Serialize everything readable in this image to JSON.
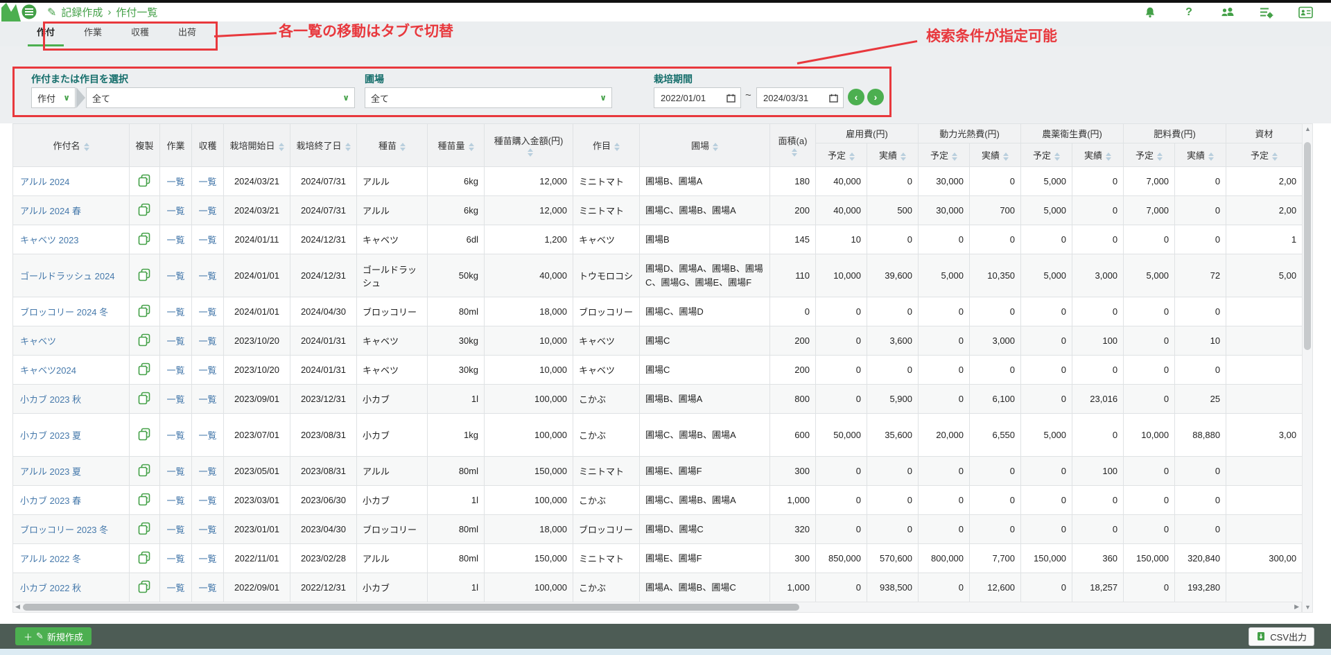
{
  "colors": {
    "accent_green": "#4caf50",
    "annotation_red": "#e8383d",
    "link_blue": "#4679ab",
    "label_teal": "#156e6b",
    "footer_bg": "#4d5c55"
  },
  "app": {
    "breadcrumb_section": "記録作成",
    "breadcrumb_sep": "›",
    "breadcrumb_page": "作付一覧",
    "help_icon_glyph": "?"
  },
  "tabs": {
    "items": [
      {
        "label": "作付",
        "active": true
      },
      {
        "label": "作業",
        "active": false
      },
      {
        "label": "収穫",
        "active": false
      },
      {
        "label": "出荷",
        "active": false
      }
    ]
  },
  "annotations": {
    "tabs_note": "各一覧の移動はタブで切替",
    "search_note": "検索条件が指定可能"
  },
  "filters": {
    "planting_label": "作付または作目を選択",
    "type_value": "作付",
    "type_chevron": "∨",
    "planting_value": "全て",
    "chevron": "∨",
    "field_label": "圃場",
    "field_value": "全て",
    "period_label": "栽培期間",
    "date_from": "2022/01/01",
    "date_to": "2024/03/31",
    "tilde": "~",
    "prev_glyph": "‹",
    "next_glyph": "›"
  },
  "table": {
    "headers": {
      "name": "作付名",
      "copy": "複製",
      "work": "作業",
      "harvest": "収穫",
      "start": "栽培開始日",
      "end": "栽培終了日",
      "seed": "種苗",
      "seed_qty": "種苗量",
      "seed_cost": "種苗購入金額(円)",
      "crop": "作目",
      "field": "圃場",
      "area": "面積(a)",
      "groups": [
        "雇用費(円)",
        "動力光熱費(円)",
        "農薬衛生費(円)",
        "肥料費(円)",
        "資材"
      ],
      "plan": "予定",
      "actual": "実績"
    },
    "link_label": "一覧",
    "rows": [
      {
        "name": "アルル 2024",
        "start": "2024/03/21",
        "end": "2024/07/31",
        "seed": "アルル",
        "qty": "6kg",
        "price": "12,000",
        "crop": "ミニトマト",
        "fields": "圃場B、圃場A",
        "area": "180",
        "costs": [
          "40,000",
          "0",
          "30,000",
          "0",
          "5,000",
          "0",
          "7,000",
          "0",
          "2,00"
        ],
        "tall": false
      },
      {
        "name": "アルル 2024 春",
        "start": "2024/03/21",
        "end": "2024/07/31",
        "seed": "アルル",
        "qty": "6kg",
        "price": "12,000",
        "crop": "ミニトマト",
        "fields": "圃場C、圃場B、圃場A",
        "area": "200",
        "costs": [
          "40,000",
          "500",
          "30,000",
          "700",
          "5,000",
          "0",
          "7,000",
          "0",
          "2,00"
        ],
        "tall": false
      },
      {
        "name": "キャベツ 2023",
        "start": "2024/01/11",
        "end": "2024/12/31",
        "seed": "キャベツ",
        "qty": "6dl",
        "price": "1,200",
        "crop": "キャベツ",
        "fields": "圃場B",
        "area": "145",
        "costs": [
          "10",
          "0",
          "0",
          "0",
          "0",
          "0",
          "0",
          "0",
          "1"
        ],
        "tall": false
      },
      {
        "name": "ゴールドラッシュ 2024",
        "start": "2024/01/01",
        "end": "2024/12/31",
        "seed": "ゴールドラッシュ",
        "qty": "50kg",
        "price": "40,000",
        "crop": "トウモロコシ",
        "fields": "圃場D、圃場A、圃場B、圃場C、圃場G、圃場E、圃場F",
        "area": "110",
        "costs": [
          "10,000",
          "39,600",
          "5,000",
          "10,350",
          "5,000",
          "3,000",
          "5,000",
          "72",
          "5,00"
        ],
        "tall": true
      },
      {
        "name": "ブロッコリー 2024 冬",
        "start": "2024/01/01",
        "end": "2024/04/30",
        "seed": "ブロッコリー",
        "qty": "80ml",
        "price": "18,000",
        "crop": "ブロッコリー",
        "fields": "圃場C、圃場D",
        "area": "0",
        "costs": [
          "0",
          "0",
          "0",
          "0",
          "0",
          "0",
          "0",
          "0",
          ""
        ],
        "tall": false
      },
      {
        "name": "キャベツ",
        "start": "2023/10/20",
        "end": "2024/01/31",
        "seed": "キャベツ",
        "qty": "30kg",
        "price": "10,000",
        "crop": "キャベツ",
        "fields": "圃場C",
        "area": "200",
        "costs": [
          "0",
          "3,600",
          "0",
          "3,000",
          "0",
          "100",
          "0",
          "10",
          ""
        ],
        "tall": false
      },
      {
        "name": "キャベツ2024",
        "start": "2023/10/20",
        "end": "2024/01/31",
        "seed": "キャベツ",
        "qty": "30kg",
        "price": "10,000",
        "crop": "キャベツ",
        "fields": "圃場C",
        "area": "200",
        "costs": [
          "0",
          "0",
          "0",
          "0",
          "0",
          "0",
          "0",
          "0",
          ""
        ],
        "tall": false
      },
      {
        "name": "小カブ 2023 秋",
        "start": "2023/09/01",
        "end": "2023/12/31",
        "seed": "小カブ",
        "qty": "1l",
        "price": "100,000",
        "crop": "こかぶ",
        "fields": "圃場B、圃場A",
        "area": "800",
        "costs": [
          "0",
          "5,900",
          "0",
          "6,100",
          "0",
          "23,016",
          "0",
          "25",
          ""
        ],
        "tall": false
      },
      {
        "name": "小カブ 2023 夏",
        "start": "2023/07/01",
        "end": "2023/08/31",
        "seed": "小カブ",
        "qty": "1kg",
        "price": "100,000",
        "crop": "こかぶ",
        "fields": "圃場C、圃場B、圃場A",
        "area": "600",
        "costs": [
          "50,000",
          "35,600",
          "20,000",
          "6,550",
          "5,000",
          "0",
          "10,000",
          "88,880",
          "3,00"
        ],
        "tall": true
      },
      {
        "name": "アルル 2023 夏",
        "start": "2023/05/01",
        "end": "2023/08/31",
        "seed": "アルル",
        "qty": "80ml",
        "price": "150,000",
        "crop": "ミニトマト",
        "fields": "圃場E、圃場F",
        "area": "300",
        "costs": [
          "0",
          "0",
          "0",
          "0",
          "0",
          "100",
          "0",
          "0",
          ""
        ],
        "tall": false
      },
      {
        "name": "小カブ 2023 春",
        "start": "2023/03/01",
        "end": "2023/06/30",
        "seed": "小カブ",
        "qty": "1l",
        "price": "100,000",
        "crop": "こかぶ",
        "fields": "圃場C、圃場B、圃場A",
        "area": "1,000",
        "costs": [
          "0",
          "0",
          "0",
          "0",
          "0",
          "0",
          "0",
          "0",
          ""
        ],
        "tall": false
      },
      {
        "name": "ブロッコリー 2023 冬",
        "start": "2023/01/01",
        "end": "2023/04/30",
        "seed": "ブロッコリー",
        "qty": "80ml",
        "price": "18,000",
        "crop": "ブロッコリー",
        "fields": "圃場D、圃場C",
        "area": "320",
        "costs": [
          "0",
          "0",
          "0",
          "0",
          "0",
          "0",
          "0",
          "0",
          ""
        ],
        "tall": false
      },
      {
        "name": "アルル 2022 冬",
        "start": "2022/11/01",
        "end": "2023/02/28",
        "seed": "アルル",
        "qty": "80ml",
        "price": "150,000",
        "crop": "ミニトマト",
        "fields": "圃場E、圃場F",
        "area": "300",
        "costs": [
          "850,000",
          "570,600",
          "800,000",
          "7,700",
          "150,000",
          "360",
          "150,000",
          "320,840",
          "300,00"
        ],
        "tall": false
      },
      {
        "name": "小カブ 2022 秋",
        "start": "2022/09/01",
        "end": "2022/12/31",
        "seed": "小カブ",
        "qty": "1l",
        "price": "100,000",
        "crop": "こかぶ",
        "fields": "圃場A、圃場B、圃場C",
        "area": "1,000",
        "costs": [
          "0",
          "938,500",
          "0",
          "12,600",
          "0",
          "18,257",
          "0",
          "193,280",
          ""
        ],
        "tall": false
      }
    ]
  },
  "footer": {
    "new_button": "新規作成",
    "new_plus_glyph": "＋",
    "csv_button": "CSV出力"
  }
}
